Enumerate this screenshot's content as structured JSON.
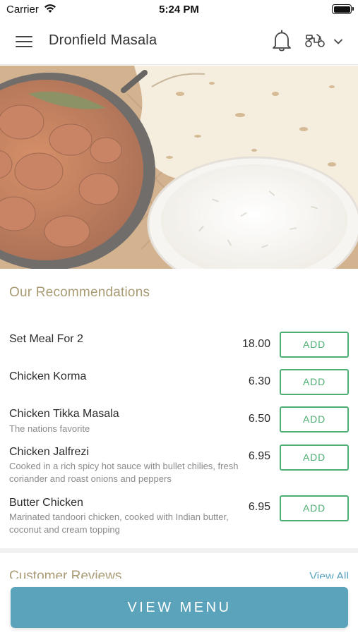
{
  "status_bar": {
    "carrier": "Carrier",
    "time": "5:24 PM",
    "icons": [
      "wifi-icon",
      "battery-icon"
    ]
  },
  "header": {
    "title": "Dronfield Masala",
    "icons": [
      "menu-icon",
      "bell-icon",
      "scooter-icon",
      "chevron-down-icon"
    ]
  },
  "hero": {
    "description": "hero-image"
  },
  "recommendations": {
    "title": "Our Recommendations",
    "add_label": "ADD",
    "items": [
      {
        "name": "Set Meal For 2",
        "description": "",
        "price": "18.00"
      },
      {
        "name": "Chicken Korma",
        "description": "",
        "price": "6.30"
      },
      {
        "name": "Chicken Tikka Masala",
        "description": "The nations favorite",
        "price": "6.50"
      },
      {
        "name": "Chicken Jalfrezi",
        "description": "Cooked in a rich spicy hot sauce with bullet chilies, fresh coriander and roast onions and peppers",
        "price": "6.95"
      },
      {
        "name": "Butter Chicken",
        "description": "Marinated tandoori chicken, cooked with Indian butter, coconut and cream topping",
        "price": "6.95"
      }
    ]
  },
  "reviews": {
    "title": "Customer Reviews",
    "view_all": "View All"
  },
  "footer": {
    "view_menu_label": "VIEW MENU"
  },
  "colors": {
    "accent_green": "#4fae73",
    "section_gold": "#a89a73",
    "button_blue": "#5ba3bb",
    "link_blue": "#5aa4c0"
  }
}
